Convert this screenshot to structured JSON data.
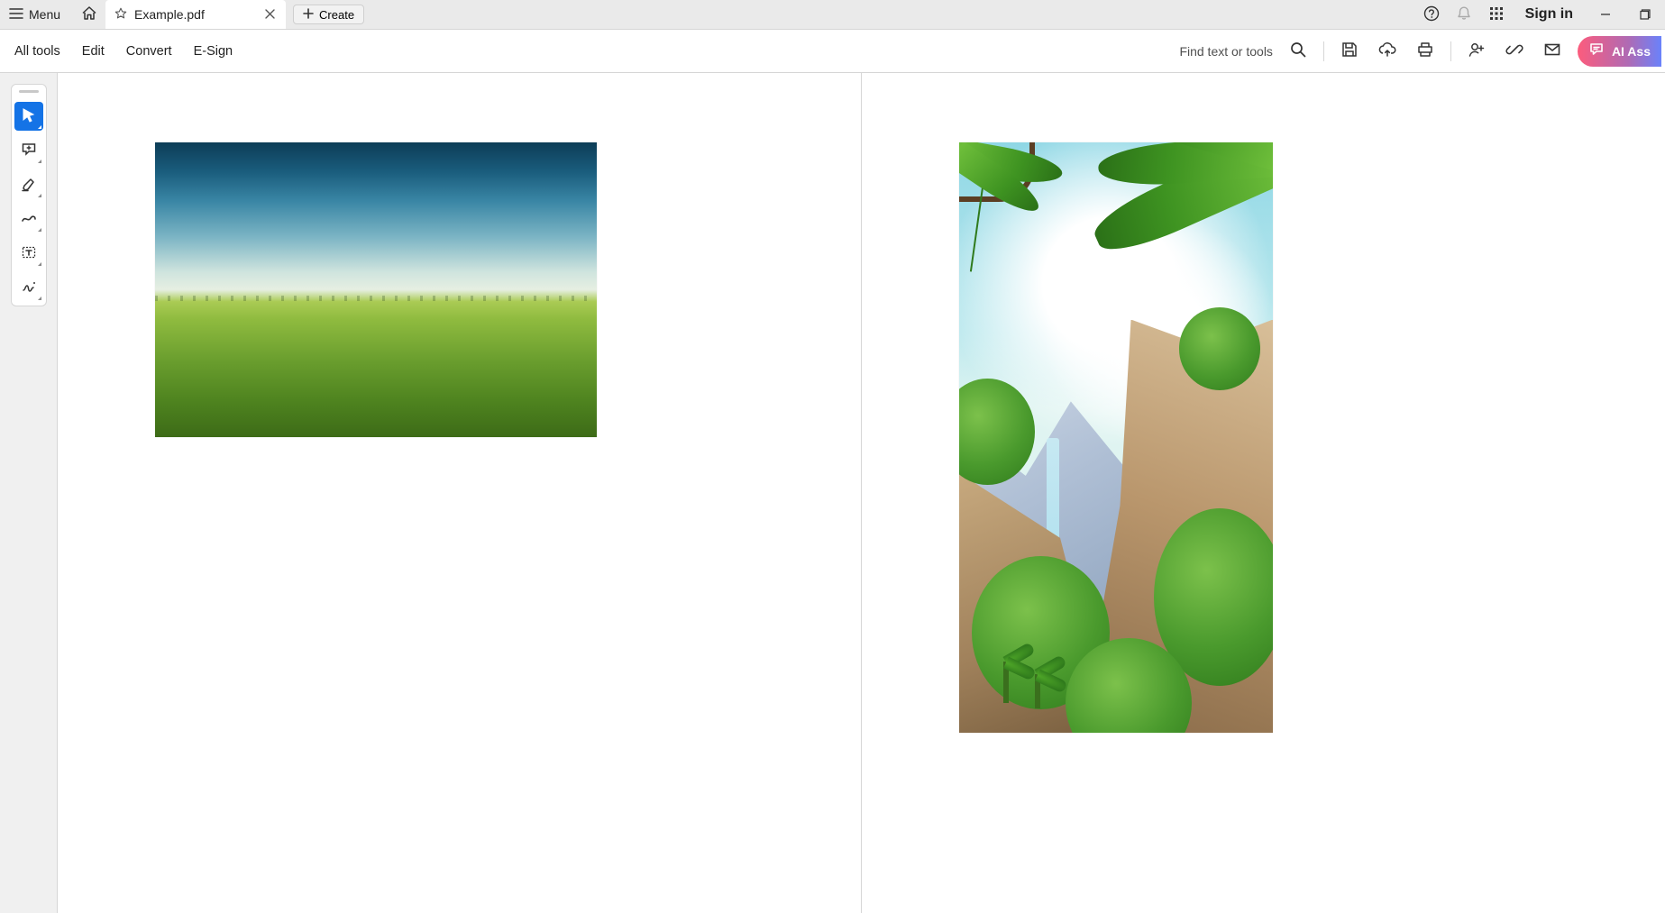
{
  "titlebar": {
    "menu_label": "Menu",
    "tab_title": "Example.pdf",
    "create_label": "Create",
    "signin_label": "Sign in"
  },
  "toolbar": {
    "items": [
      "All tools",
      "Edit",
      "Convert",
      "E-Sign"
    ],
    "find_label": "Find text or tools",
    "ai_label": "AI Ass"
  },
  "left_palette": {
    "tools": [
      {
        "name": "select-tool",
        "active": true
      },
      {
        "name": "comment-tool",
        "active": false
      },
      {
        "name": "highlight-tool",
        "active": false
      },
      {
        "name": "draw-tool",
        "active": false
      },
      {
        "name": "text-box-tool",
        "active": false
      },
      {
        "name": "fill-sign-tool",
        "active": false
      }
    ]
  },
  "document": {
    "pages": [
      {
        "content": {
          "kind": "photo",
          "subject": "green-field-landscape"
        }
      },
      {
        "content": {
          "kind": "illustration",
          "subject": "tropical-cliffs-jungle"
        }
      }
    ]
  }
}
